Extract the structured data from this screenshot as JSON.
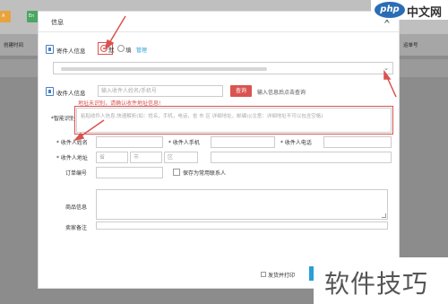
{
  "background": {
    "btn_colors": [
      "#e8a33c",
      "#4aa862"
    ],
    "btn_labels": [
      "A",
      "En"
    ],
    "headers": [
      "创建时间",
      "运单号"
    ]
  },
  "watermark": {
    "logo_circle": "php",
    "logo_text": "中文网",
    "bottom_text": "软件技巧"
  },
  "modal": {
    "title": "信息",
    "close_icon": "×"
  },
  "sender": {
    "section_label": "寄件人信息",
    "option_selected": "默",
    "option_other": "填",
    "manage_link": "管理"
  },
  "receiver": {
    "section_label": "收件人信息",
    "search_placeholder": "输入收件人姓名/手机号",
    "search_button": "查询",
    "search_hint": "输入信息后点击查询",
    "alert_text": "地址未识别，请确认收件地址信息!",
    "smart_label": "*智能识别",
    "smart_placeholder": "粘贴收件人信息,快速解析(如：姓名，手机，电话，省 市 区 详细地址，邮编)|(注意：详细地址不可以包含空格)"
  },
  "fields": {
    "name_label": "* 收件人姓名",
    "mobile_label": "* 收件人手机",
    "phone_label": "* 收件人电话",
    "address_label": "* 收件人地址",
    "province_placeholder": "省",
    "city_placeholder": "市",
    "district_placeholder": "区",
    "order_label": "订单编号",
    "save_label": "保存为常用联系人",
    "goods_label": "商品信息",
    "remark_label": "卖家备注"
  },
  "footer": {
    "print_label": "发货并打印"
  },
  "colors": {
    "accent_red": "#d9534f",
    "link_blue": "#2a9fd6"
  }
}
